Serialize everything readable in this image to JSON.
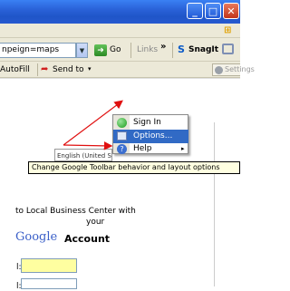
{
  "window": {
    "minimize": "_",
    "maximize": "□",
    "close": "✕"
  },
  "address_bar": {
    "url": "npeign=maps",
    "go_label": "Go",
    "links_label": "Links",
    "links_chevron": "»",
    "snagit_label": "SnagIt"
  },
  "google_toolbar": {
    "autofill_label": "AutoFill",
    "send_to_label": "Send to",
    "send_to_caret": "▾",
    "settings_label": "Settings"
  },
  "menu": {
    "items": [
      {
        "label": "Sign In",
        "icon": "green-circle-icon"
      },
      {
        "label": "Options...",
        "icon": "options-window-icon",
        "highlighted": true
      },
      {
        "label": "Help",
        "icon": "help-icon",
        "submenu": true
      }
    ],
    "submenu_caret": "▸"
  },
  "tooltip": "Change Google Toolbar behavior and layout options",
  "page": {
    "language_value": "English (United S",
    "line1": "to Local Business Center with",
    "line2": "your",
    "google_word": "Google",
    "account_word": "Account",
    "field1_label": "l:",
    "field2_label": "l:"
  },
  "colors": {
    "titlebar": "#2a62d8",
    "annotation_arrow": "#e01010",
    "menu_highlight": "#316ac5",
    "tooltip_bg": "#ffffe1"
  }
}
